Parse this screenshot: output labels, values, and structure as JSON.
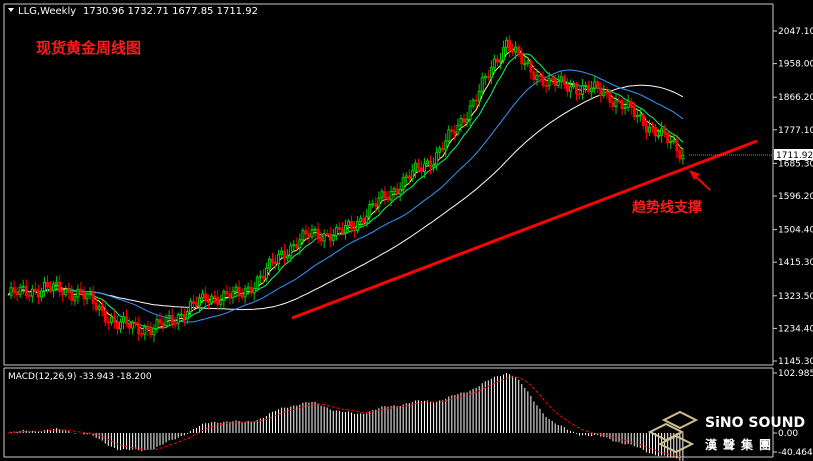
{
  "header": {
    "symbol": "LLG,Weekly",
    "ohlc": "1730.96 1732.71 1677.85 1711.92"
  },
  "title": "现货黄金周线图",
  "annotation": "趋势线支撑",
  "macd_label": "MACD(12,26,9) -33.943 -18.200",
  "logo": {
    "main": "SiNO SOUND",
    "sub": "漢聲集團"
  },
  "price_axis": {
    "ticks": [
      "2047.10",
      "1958.00",
      "1866.20",
      "1777.10",
      "1685.30",
      "1596.20",
      "1504.40",
      "1415.30",
      "1323.50",
      "1234.40",
      "1145.30"
    ],
    "current_price": "1711.92"
  },
  "macd_axis": {
    "ticks": [
      "102.985",
      "0.00",
      "-40.464"
    ]
  },
  "colors": {
    "background": "#000000",
    "bull_candle": "#00cc00",
    "bear_candle": "#ff0000",
    "ma_short": "#ffff66",
    "ma_mid": "#00ff66",
    "ma_blue": "#3399ff",
    "ma_long": "#ffffff",
    "trendline": "#ff0000",
    "macd_hist": "#ffffff",
    "macd_signal": "#ff0000"
  },
  "chart_data": {
    "type": "candlestick",
    "timeframe": "Weekly",
    "ylim": [
      1145.3,
      2090
    ],
    "macd_ylim": [
      -45,
      108
    ],
    "series": [
      {
        "name": "price",
        "kind": "candlestick"
      },
      {
        "name": "MACD(12,26,9)",
        "kind": "histogram+signal"
      }
    ]
  }
}
